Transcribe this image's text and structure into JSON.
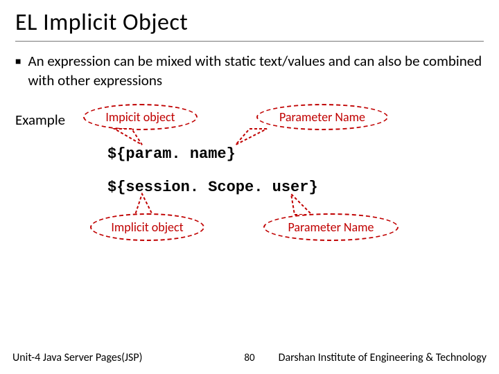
{
  "title": "EL Implicit Object",
  "bullet": "An expression can be mixed with static text/values and can also be combined with other expressions",
  "example_label": "Example",
  "callouts": {
    "top_left": "Impicit object",
    "top_right": "Parameter Name",
    "bottom_left": "Implicit object",
    "bottom_right": "Parameter Name"
  },
  "code": {
    "line1": "${param. name}",
    "line2": "${session. Scope. user}"
  },
  "footer": {
    "left": "Unit-4 Java Server Pages(JSP)",
    "page": "80",
    "right": "Darshan Institute of Engineering & Technology"
  }
}
